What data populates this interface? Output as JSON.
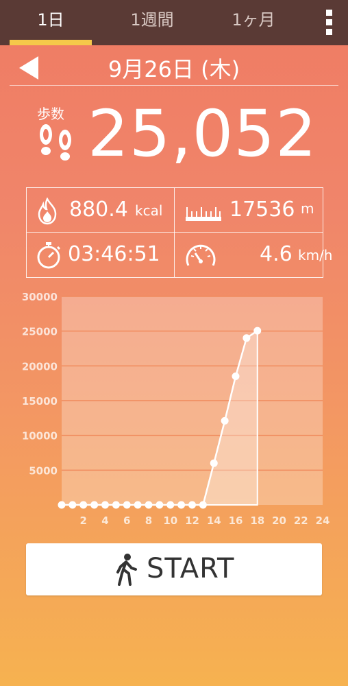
{
  "tabs": [
    {
      "label": "1日",
      "active": true
    },
    {
      "label": "1週間",
      "active": false
    },
    {
      "label": "1ヶ月",
      "active": false
    }
  ],
  "date": "9月26日 (木)",
  "steps": {
    "label": "歩数",
    "value": "25,052"
  },
  "stats": {
    "calories": {
      "value": "880.4",
      "unit": "kcal",
      "icon": "flame-icon"
    },
    "distance": {
      "value": "17536",
      "unit": "m",
      "icon": "ruler-icon"
    },
    "duration": {
      "value": "03:46:51",
      "icon": "stopwatch-icon"
    },
    "speed": {
      "value": "4.6",
      "unit": "km/h",
      "icon": "speedometer-icon"
    }
  },
  "start_button": {
    "label": "START",
    "icon": "walking-person-icon"
  },
  "chart_data": {
    "type": "line",
    "x": [
      0,
      1,
      2,
      3,
      4,
      5,
      6,
      7,
      8,
      9,
      10,
      11,
      12,
      13,
      14,
      15,
      16,
      17,
      18
    ],
    "values": [
      0,
      0,
      0,
      0,
      0,
      0,
      0,
      0,
      0,
      0,
      0,
      0,
      0,
      0,
      6000,
      12100,
      18500,
      24000,
      25052
    ],
    "xticks": [
      2,
      4,
      6,
      8,
      10,
      12,
      14,
      16,
      18,
      20,
      22,
      24
    ],
    "yticks": [
      5000,
      10000,
      15000,
      20000,
      25000,
      30000
    ],
    "xlim": [
      0,
      24
    ],
    "ylim": [
      0,
      30000
    ],
    "grid": true
  }
}
